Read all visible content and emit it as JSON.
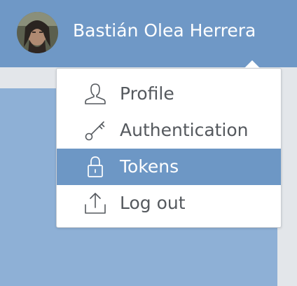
{
  "user": {
    "name": "Bastián Olea Herrera"
  },
  "menu": {
    "items": [
      {
        "label": "Profile",
        "icon": "user-icon",
        "active": false
      },
      {
        "label": "Authentication",
        "icon": "key-icon",
        "active": false
      },
      {
        "label": "Tokens",
        "icon": "lock-icon",
        "active": true
      },
      {
        "label": "Log out",
        "icon": "logout-icon",
        "active": false
      }
    ]
  },
  "colors": {
    "header": "#6f98c6",
    "active_item": "#6d97c5",
    "item_text": "#55595e"
  }
}
